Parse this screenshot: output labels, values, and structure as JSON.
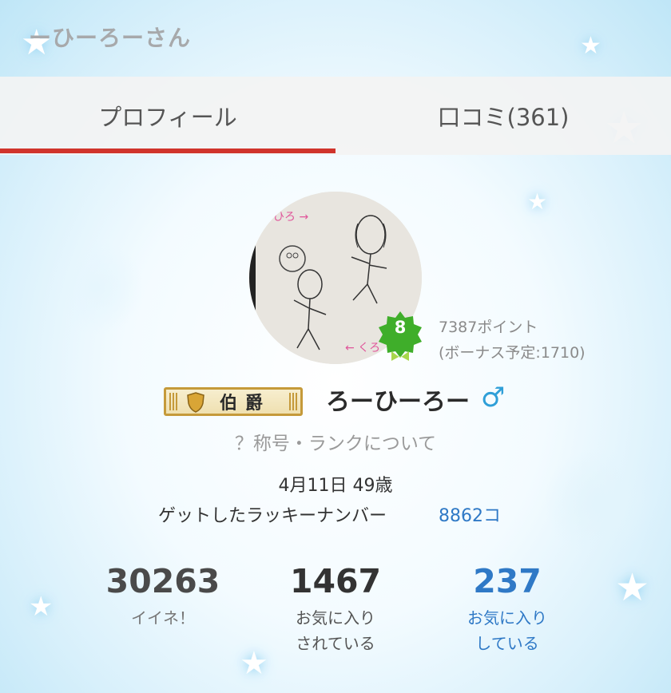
{
  "header": {
    "title": "ーひーろーさん"
  },
  "tabs": [
    {
      "label": "プロフィール",
      "active": true
    },
    {
      "label": "口コミ(361)",
      "active": false
    }
  ],
  "profile": {
    "level": "8",
    "points": "7387ポイント",
    "bonus": "(ボーナス予定:1710)",
    "rank_title": "伯爵",
    "name": "ろーひーろー",
    "gender_symbol": "♂",
    "rank_about": "？称号・ランクについて",
    "birthday_age": "4月11日 49歳",
    "lucky_label": "ゲットしたラッキーナンバー",
    "lucky_value": "8862コ"
  },
  "stats": [
    {
      "value": "30263",
      "label_line1": "イイネ！",
      "label_line2": ""
    },
    {
      "value": "1467",
      "label_line1": "お気に入り",
      "label_line2": "されている"
    },
    {
      "value": "237",
      "label_line1": "お気に入り",
      "label_line2": "している"
    }
  ],
  "colors": {
    "accent_red": "#d0342c",
    "link_blue": "#2f79c6",
    "badge_green": "#3fae2a"
  },
  "icons": {
    "gender": "male-symbol-icon",
    "rank": "shield-icon",
    "level": "laurel-badge-icon",
    "decor": "star-sparkle-icon"
  }
}
